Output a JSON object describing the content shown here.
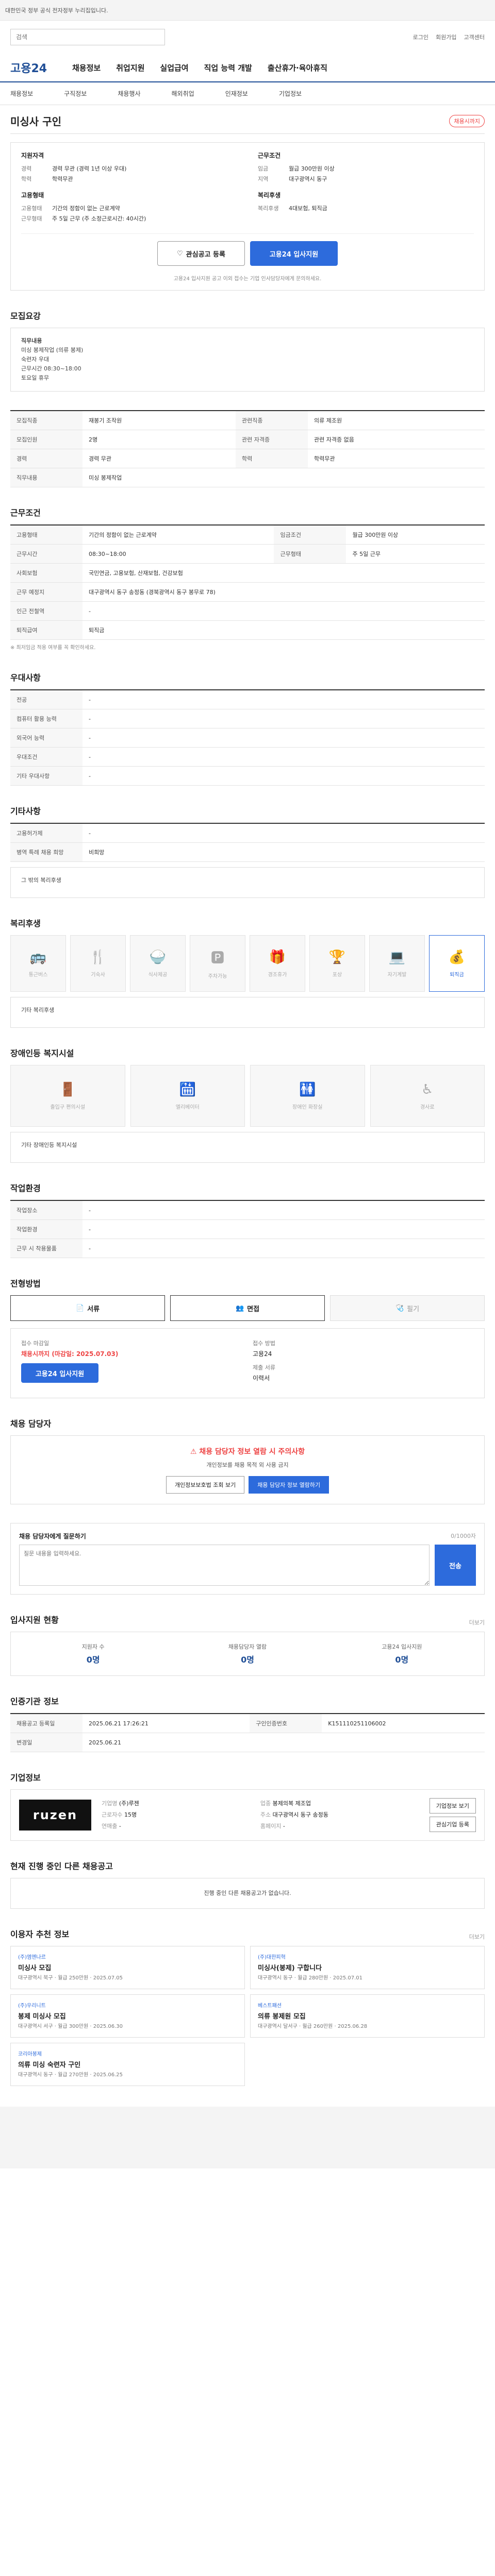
{
  "topbar": {
    "notice": "대한민국 정부 공식 전자정부 누리집입니다."
  },
  "search": {
    "placeholder": "검색",
    "util": [
      "로그인",
      "회원가입",
      "고객센터"
    ]
  },
  "gnb": {
    "logo": "고용24",
    "items": [
      "채용정보",
      "취업지원",
      "실업급여",
      "직업 능력 개발",
      "출산휴가·육아휴직"
    ]
  },
  "lnb": [
    "채용정보",
    "구직정보",
    "채용행사",
    "해외취업",
    "인재정보",
    "기업정보"
  ],
  "job": {
    "title": "미싱사 구인",
    "status": "채용시까지"
  },
  "summary": {
    "left_title": "지원자격",
    "left": [
      {
        "k": "경력",
        "v": "경력 무관 (경력 1년 이상 우대)"
      },
      {
        "k": "학력",
        "v": "학력무관"
      }
    ],
    "left2_title": "고용형태",
    "left2": [
      {
        "k": "고용형태",
        "v": "기간의 정함이 없는 근로계약"
      },
      {
        "k": "근무형태",
        "v": "주 5일 근무 (주 소정근로시간: 40시간)"
      }
    ],
    "right_title": "근무조건",
    "right": [
      {
        "k": "임금",
        "v": "월급 300만원 이상"
      },
      {
        "k": "지역",
        "v": "대구광역시 동구"
      }
    ],
    "right2_title": "복리후생",
    "right2": [
      {
        "k": "복리후생",
        "v": "4대보험, 퇴직금"
      }
    ],
    "btn_save": "관심공고 등록",
    "btn_apply": "고용24 입사지원",
    "note": "고용24 입사지원 공고 이외 접수는 기업 인사담당자에게 문의하세요."
  },
  "detail": {
    "title": "모집요강",
    "text": [
      "직무내용",
      "미싱 봉제작업 (의류 봉제)",
      "숙련자 우대",
      "근무시간 08:30~18:00",
      "토요일 휴무"
    ]
  },
  "recruit": {
    "title": "모집요강",
    "rows": [
      {
        "k": "모집직종",
        "v": "재봉기 조작원"
      },
      {
        "k": "관련직종",
        "v": "의류 제조원"
      },
      {
        "k": "모집인원",
        "v": "2명"
      },
      {
        "k": "관련 자격증",
        "v": "관련 자격증 없음"
      },
      {
        "k": "경력",
        "v": "경력 무관"
      },
      {
        "k": "학력",
        "v": "학력무관"
      },
      {
        "k": "직무내용",
        "v": "미싱 봉제작업"
      }
    ]
  },
  "cond": {
    "title": "근무조건",
    "rows": [
      {
        "k": "고용형태",
        "v": "기간의 정함이 없는 근로계약"
      },
      {
        "k": "임금조건",
        "v": "월급 300만원 이상"
      },
      {
        "k": "근무시간",
        "v": "08:30~18:00"
      },
      {
        "k": "근무형태",
        "v": "주 5일 근무"
      },
      {
        "k": "사회보험",
        "v": "국민연금, 고용보험, 산재보험, 건강보험"
      },
      {
        "k": "근무 예정지",
        "v": "대구광역시 동구 송정동 (경북광역시 동구 봉무로 78)"
      },
      {
        "k": "인근 전철역",
        "v": "-"
      },
      {
        "k": "퇴직급여",
        "v": "퇴직금"
      }
    ],
    "note": "※ 최저임금 적용 여부를 꼭 확인하세요."
  },
  "pref": {
    "title": "우대사항",
    "rows": [
      {
        "k": "전공",
        "v": "-"
      },
      {
        "k": "컴퓨터 활용 능력",
        "v": "-"
      },
      {
        "k": "외국어 능력",
        "v": "-"
      },
      {
        "k": "우대조건",
        "v": "-"
      },
      {
        "k": "기타 우대사항",
        "v": "-"
      }
    ]
  },
  "extra": {
    "title": "기타사항",
    "rows": [
      {
        "k": "고용허가제",
        "v": "-"
      },
      {
        "k": "병역 특례 채용 희망",
        "v": "비희망"
      }
    ],
    "box": "그 밖의 복리후생"
  },
  "welfare": {
    "title": "복리후생",
    "items": [
      {
        "g": "🚌",
        "label": "통근버스",
        "on": false
      },
      {
        "g": "🍴",
        "label": "기숙사",
        "on": false
      },
      {
        "g": "🍚",
        "label": "식사제공",
        "on": false
      },
      {
        "g": "🅿",
        "label": "주차가능",
        "on": false
      },
      {
        "g": "🎁",
        "label": "경조휴가",
        "on": false
      },
      {
        "g": "🏆",
        "label": "포상",
        "on": false
      },
      {
        "g": "💻",
        "label": "자기계발",
        "on": false
      },
      {
        "g": "💰",
        "label": "퇴직금",
        "on": true
      }
    ],
    "note": "기타 복리후생"
  },
  "facility": {
    "title": "장애인등 복지시설",
    "items": [
      {
        "g": "🚪",
        "label": "출입구 편의시설"
      },
      {
        "g": "🛗",
        "label": "엘리베이터"
      },
      {
        "g": "🚻",
        "label": "장애인 화장실"
      },
      {
        "g": "♿",
        "label": "경사로"
      }
    ],
    "note": "기타 장애인등 복지시설"
  },
  "workenv": {
    "title": "작업환경",
    "rows": [
      {
        "k": "작업장소",
        "v": "-"
      },
      {
        "k": "작업환경",
        "v": "-"
      },
      {
        "k": "근무 시 착용물품",
        "v": "-"
      }
    ]
  },
  "method": {
    "title": "전형방법",
    "tabs": [
      {
        "g": "📄",
        "label": "서류",
        "on": true
      },
      {
        "g": "👥",
        "label": "면접",
        "on": true
      },
      {
        "g": "🩺",
        "label": "필기",
        "on": false
      }
    ],
    "apply_k": "접수 마감일",
    "apply_v": "채용시까지 (마감일: 2025.07.03)",
    "apply2_k": "접수 방법",
    "apply2_v": "고용24",
    "apply3_k": "제출 서류",
    "apply3_v": "이력서",
    "btn": "고용24 입사지원"
  },
  "contact": {
    "title": "채용 담당자",
    "warn": "채용 담당자 정보 열람 시 주의사항",
    "text": "개인정보를 채용 목적 외 사용 금지",
    "btn1": "개인정보보호법 조회 보기",
    "btn2": "채용 담당자 정보 열람하기"
  },
  "qna": {
    "title": "채용 담당자에게 질문하기",
    "placeholder": "질문 내용을 입력하세요.",
    "send": "전송",
    "count": "0/1000자"
  },
  "stats": {
    "title": "입사지원 현황",
    "more": "더보기",
    "items": [
      {
        "k": "지원자 수",
        "v": "0명"
      },
      {
        "k": "채용담당자 열람",
        "v": "0명"
      },
      {
        "k": "고용24 입사지원",
        "v": "0명"
      }
    ]
  },
  "meta": {
    "title": "인증기관 정보",
    "rows": [
      {
        "k": "채용공고 등록일",
        "v": "2025.06.21 17:26:21"
      },
      {
        "k": "구인인증번호",
        "v": "K151110251106002"
      },
      {
        "k": "변경일",
        "v": "2025.06.21"
      }
    ]
  },
  "company": {
    "title": "기업정보",
    "logo": "ruzen",
    "rows": [
      {
        "k": "기업명",
        "v": "(주)루젠"
      },
      {
        "k": "업종",
        "v": "봉제의복 제조업"
      },
      {
        "k": "근로자수",
        "v": "15명"
      },
      {
        "k": "주소",
        "v": "대구광역시 동구 송정동"
      },
      {
        "k": "연매출",
        "v": "-"
      },
      {
        "k": "홈페이지",
        "v": "-"
      }
    ],
    "btn1": "기업정보 보기",
    "btn2": "관심기업 등록"
  },
  "others": {
    "title": "현재 진행 중인 다른 채용공고",
    "empty": "진행 중인 다른 채용공고가 없습니다."
  },
  "recs": {
    "title": "이용자 추천 정보",
    "more": "더보기",
    "items": [
      {
        "co": "(주)엠엔나르",
        "tt": "미싱사 모집",
        "meta": "대구광역시 북구 · 월급 250만원 · 2025.07.05"
      },
      {
        "co": "(주)대한피혁",
        "tt": "미싱사(봉제) 구합니다",
        "meta": "대구광역시 동구 · 월급 280만원 · 2025.07.01"
      },
      {
        "co": "(주)우리니트",
        "tt": "봉제 미싱사 모집",
        "meta": "대구광역시 서구 · 월급 300만원 · 2025.06.30"
      },
      {
        "co": "베스트패션",
        "tt": "의류 봉제원 모집",
        "meta": "대구광역시 달서구 · 월급 260만원 · 2025.06.28"
      },
      {
        "co": "코리아봉제",
        "tt": "의류 미싱 숙련자 구인",
        "meta": "대구광역시 동구 · 월급 270만원 · 2025.06.25"
      }
    ]
  }
}
